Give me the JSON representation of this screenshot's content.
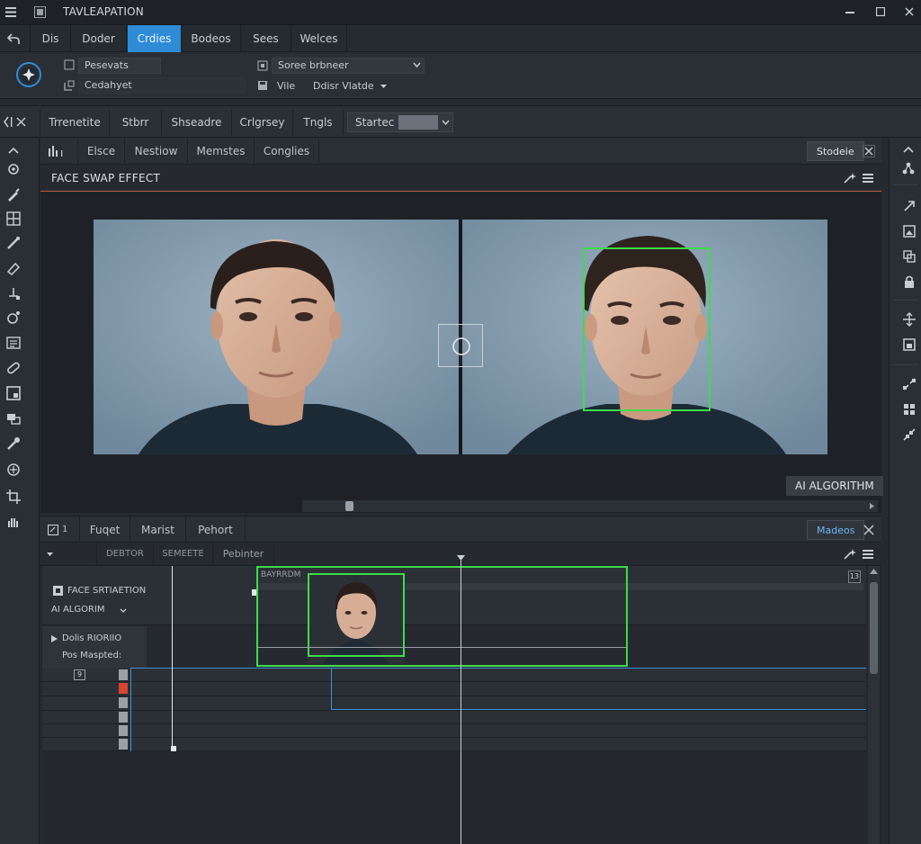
{
  "app": {
    "title": "TAVLEAPATION"
  },
  "menu": [
    "Dis",
    "Doder",
    "Crdies",
    "Bodeos",
    "Sees",
    "Welces"
  ],
  "menu_active": 2,
  "props": {
    "field1": "Pesevats",
    "field2": "Cedahyet",
    "field3": "Soree brbneer",
    "field4_label": "Vile",
    "field4_value": "Ddisr Vlatde"
  },
  "toolrow": {
    "tabs": [
      "Trrenetite",
      "Stbrr",
      "Shseadre",
      "Crlgrsey",
      "Tngls",
      "Startec"
    ]
  },
  "viewer": {
    "tabs": [
      "Elsce",
      "Nestiow",
      "Memstes",
      "Conglies"
    ],
    "right_button": "Stodeie",
    "header_title": "FACE SWAP EFFECT",
    "ai_badge": "AI ALGORITHM"
  },
  "timeline": {
    "tabs_num": "1",
    "tabs": [
      "Fuqet",
      "Marist",
      "Pehort"
    ],
    "right_button": "Madeos",
    "sub_tabs": [
      "DEBTOR",
      "SEMEETE",
      "Pebinter"
    ],
    "clip_label": "BAYRRDM",
    "clip_counter": "13",
    "track1_label": "FACE SRTIAETION",
    "track1_dropdown": "AI ALGORIM",
    "track2_label": "Dolis RIORIIO",
    "track2_sub": "Pos Maspted:",
    "row_marker": "9"
  },
  "colors": {
    "accent": "#2e8bd6",
    "selection": "#3ddc4a",
    "divider": "#c05a3c",
    "record": "#d9432f"
  }
}
